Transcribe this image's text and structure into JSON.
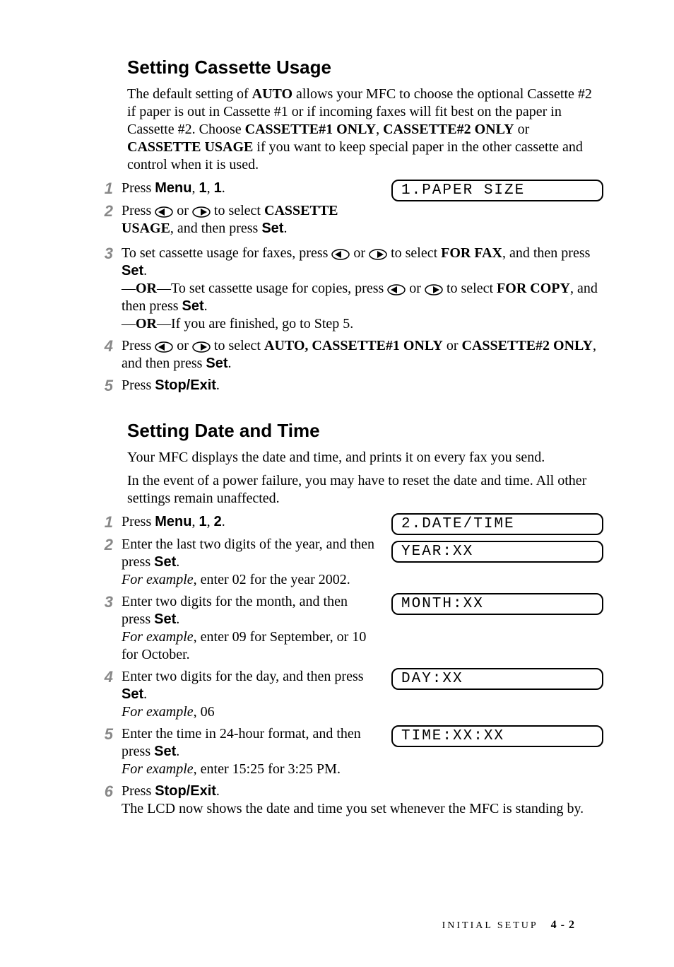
{
  "section1": {
    "heading": "Setting Cassette Usage",
    "intro_parts": {
      "p1": "The default setting of ",
      "p2": "AUTO",
      "p3": " allows your MFC to choose the optional Cassette #2 if paper is out in Cassette #1 or if incoming faxes will fit best on the paper in Cassette #2. Choose ",
      "p4": "CASSETTE#1 ONLY",
      "p5": ", ",
      "p6": "CASSETTE#2 ONLY",
      "p7": " or ",
      "p8": "CASSETTE USAGE",
      "p9": " if you want to keep special paper in the other cassette and control when it is used."
    },
    "steps": {
      "s1_a": "Press ",
      "s1_b": "Menu",
      "s1_c": ", ",
      "s1_d": "1",
      "s1_e": ", ",
      "s1_f": "1",
      "s1_g": ".",
      "lcd1": "1.PAPER SIZE",
      "s2_a": "Press ",
      "s2_b": " or ",
      "s2_c": " to select ",
      "s2_d": "CASSETTE USAGE",
      "s2_e": ", and then press ",
      "s2_f": "Set",
      "s2_g": ".",
      "s3_a": "To set cassette usage for faxes, press ",
      "s3_b": " or ",
      "s3_c": " to select ",
      "s3_d": "FOR FAX",
      "s3_e": ", and then press ",
      "s3_f": "Set",
      "s3_g": ".",
      "s3_or1a": "—",
      "s3_or1b": "OR",
      "s3_or1c": "—To set cassette usage for copies, press ",
      "s3_or1d": " or ",
      "s3_or1e": " to select ",
      "s3_or1f": "FOR COPY",
      "s3_or1g": ", and then press ",
      "s3_or1h": "Set",
      "s3_or1i": ".",
      "s3_or2a": "—",
      "s3_or2b": "OR",
      "s3_or2c": "—If you are finished, go to Step 5.",
      "s4_a": "Press ",
      "s4_b": " or ",
      "s4_c": " to select ",
      "s4_d": "AUTO, CASSETTE#1 ONLY",
      "s4_e": " or ",
      "s4_f": "CASSETTE#2 ONLY",
      "s4_g": ", and then press ",
      "s4_h": "Set",
      "s4_i": ".",
      "s5_a": "Press ",
      "s5_b": "Stop/Exit",
      "s5_c": "."
    }
  },
  "section2": {
    "heading": "Setting Date and Time",
    "intro1": "Your MFC displays the date and time, and prints it on every fax you send.",
    "intro2": "In the event of a power failure, you may have to reset the date and time. All other settings remain unaffected.",
    "steps": {
      "s1_a": "Press ",
      "s1_b": "Menu",
      "s1_c": ", ",
      "s1_d": "1",
      "s1_e": ", ",
      "s1_f": "2",
      "s1_g": ".",
      "lcd1": "2.DATE/TIME",
      "s2_a": "Enter the last two digits of the year, and then press ",
      "s2_b": "Set",
      "s2_c": ".",
      "s2_d": "For example",
      "s2_e": ", enter 02 for the year 2002.",
      "lcd2": "YEAR:XX",
      "s3_a": "Enter two digits for the month, and then press ",
      "s3_b": "Set",
      "s3_c": ".",
      "s3_d": "For example",
      "s3_e": ", enter 09 for September, or 10 for October.",
      "lcd3": "MONTH:XX",
      "s4_a": "Enter two digits for the day, and then press ",
      "s4_b": "Set",
      "s4_c": ".",
      "s4_d": "For example",
      "s4_e": ", 06",
      "lcd4": "DAY:XX",
      "s5_a": "Enter the time in 24-hour format, and then press ",
      "s5_b": "Set",
      "s5_c": ".",
      "s5_d": "For example",
      "s5_e": ", enter 15:25 for 3:25 PM.",
      "lcd5": "TIME:XX:XX",
      "s6_a": "Press ",
      "s6_b": "Stop/Exit",
      "s6_c": ".",
      "s6_d": "The LCD now shows the date and time you set whenever the MFC is standing by."
    }
  },
  "footer": {
    "label": "INITIAL SETUP",
    "page": "4 - 2"
  }
}
